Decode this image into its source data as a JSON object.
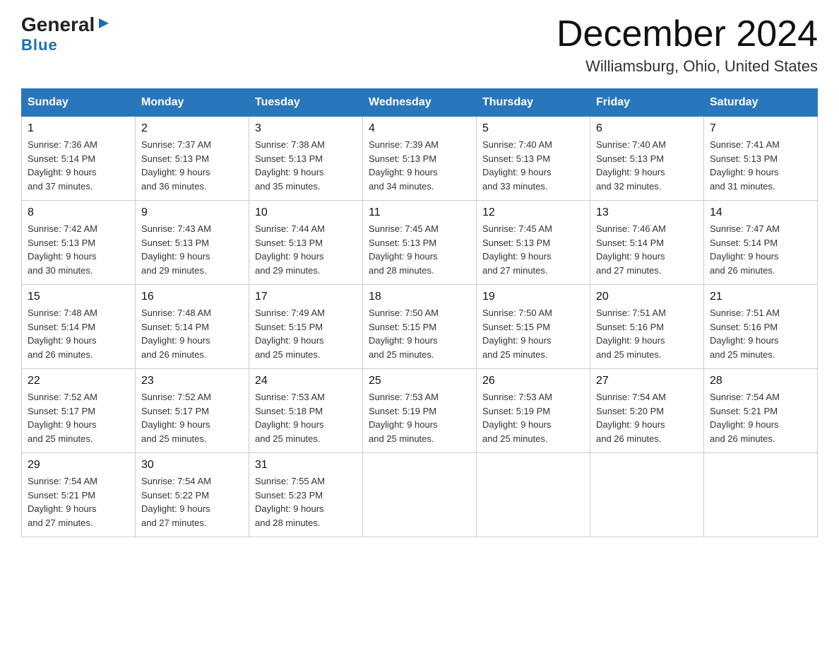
{
  "logo": {
    "line1": "General",
    "triangle": "▶",
    "line2": "Blue"
  },
  "title": "December 2024",
  "location": "Williamsburg, Ohio, United States",
  "weekdays": [
    "Sunday",
    "Monday",
    "Tuesday",
    "Wednesday",
    "Thursday",
    "Friday",
    "Saturday"
  ],
  "weeks": [
    [
      {
        "day": "1",
        "sunrise": "7:36 AM",
        "sunset": "5:14 PM",
        "daylight": "9 hours and 37 minutes."
      },
      {
        "day": "2",
        "sunrise": "7:37 AM",
        "sunset": "5:13 PM",
        "daylight": "9 hours and 36 minutes."
      },
      {
        "day": "3",
        "sunrise": "7:38 AM",
        "sunset": "5:13 PM",
        "daylight": "9 hours and 35 minutes."
      },
      {
        "day": "4",
        "sunrise": "7:39 AM",
        "sunset": "5:13 PM",
        "daylight": "9 hours and 34 minutes."
      },
      {
        "day": "5",
        "sunrise": "7:40 AM",
        "sunset": "5:13 PM",
        "daylight": "9 hours and 33 minutes."
      },
      {
        "day": "6",
        "sunrise": "7:40 AM",
        "sunset": "5:13 PM",
        "daylight": "9 hours and 32 minutes."
      },
      {
        "day": "7",
        "sunrise": "7:41 AM",
        "sunset": "5:13 PM",
        "daylight": "9 hours and 31 minutes."
      }
    ],
    [
      {
        "day": "8",
        "sunrise": "7:42 AM",
        "sunset": "5:13 PM",
        "daylight": "9 hours and 30 minutes."
      },
      {
        "day": "9",
        "sunrise": "7:43 AM",
        "sunset": "5:13 PM",
        "daylight": "9 hours and 29 minutes."
      },
      {
        "day": "10",
        "sunrise": "7:44 AM",
        "sunset": "5:13 PM",
        "daylight": "9 hours and 29 minutes."
      },
      {
        "day": "11",
        "sunrise": "7:45 AM",
        "sunset": "5:13 PM",
        "daylight": "9 hours and 28 minutes."
      },
      {
        "day": "12",
        "sunrise": "7:45 AM",
        "sunset": "5:13 PM",
        "daylight": "9 hours and 27 minutes."
      },
      {
        "day": "13",
        "sunrise": "7:46 AM",
        "sunset": "5:14 PM",
        "daylight": "9 hours and 27 minutes."
      },
      {
        "day": "14",
        "sunrise": "7:47 AM",
        "sunset": "5:14 PM",
        "daylight": "9 hours and 26 minutes."
      }
    ],
    [
      {
        "day": "15",
        "sunrise": "7:48 AM",
        "sunset": "5:14 PM",
        "daylight": "9 hours and 26 minutes."
      },
      {
        "day": "16",
        "sunrise": "7:48 AM",
        "sunset": "5:14 PM",
        "daylight": "9 hours and 26 minutes."
      },
      {
        "day": "17",
        "sunrise": "7:49 AM",
        "sunset": "5:15 PM",
        "daylight": "9 hours and 25 minutes."
      },
      {
        "day": "18",
        "sunrise": "7:50 AM",
        "sunset": "5:15 PM",
        "daylight": "9 hours and 25 minutes."
      },
      {
        "day": "19",
        "sunrise": "7:50 AM",
        "sunset": "5:15 PM",
        "daylight": "9 hours and 25 minutes."
      },
      {
        "day": "20",
        "sunrise": "7:51 AM",
        "sunset": "5:16 PM",
        "daylight": "9 hours and 25 minutes."
      },
      {
        "day": "21",
        "sunrise": "7:51 AM",
        "sunset": "5:16 PM",
        "daylight": "9 hours and 25 minutes."
      }
    ],
    [
      {
        "day": "22",
        "sunrise": "7:52 AM",
        "sunset": "5:17 PM",
        "daylight": "9 hours and 25 minutes."
      },
      {
        "day": "23",
        "sunrise": "7:52 AM",
        "sunset": "5:17 PM",
        "daylight": "9 hours and 25 minutes."
      },
      {
        "day": "24",
        "sunrise": "7:53 AM",
        "sunset": "5:18 PM",
        "daylight": "9 hours and 25 minutes."
      },
      {
        "day": "25",
        "sunrise": "7:53 AM",
        "sunset": "5:19 PM",
        "daylight": "9 hours and 25 minutes."
      },
      {
        "day": "26",
        "sunrise": "7:53 AM",
        "sunset": "5:19 PM",
        "daylight": "9 hours and 25 minutes."
      },
      {
        "day": "27",
        "sunrise": "7:54 AM",
        "sunset": "5:20 PM",
        "daylight": "9 hours and 26 minutes."
      },
      {
        "day": "28",
        "sunrise": "7:54 AM",
        "sunset": "5:21 PM",
        "daylight": "9 hours and 26 minutes."
      }
    ],
    [
      {
        "day": "29",
        "sunrise": "7:54 AM",
        "sunset": "5:21 PM",
        "daylight": "9 hours and 27 minutes."
      },
      {
        "day": "30",
        "sunrise": "7:54 AM",
        "sunset": "5:22 PM",
        "daylight": "9 hours and 27 minutes."
      },
      {
        "day": "31",
        "sunrise": "7:55 AM",
        "sunset": "5:23 PM",
        "daylight": "9 hours and 28 minutes."
      },
      null,
      null,
      null,
      null
    ]
  ],
  "labels": {
    "sunrise": "Sunrise:",
    "sunset": "Sunset:",
    "daylight": "Daylight:"
  }
}
